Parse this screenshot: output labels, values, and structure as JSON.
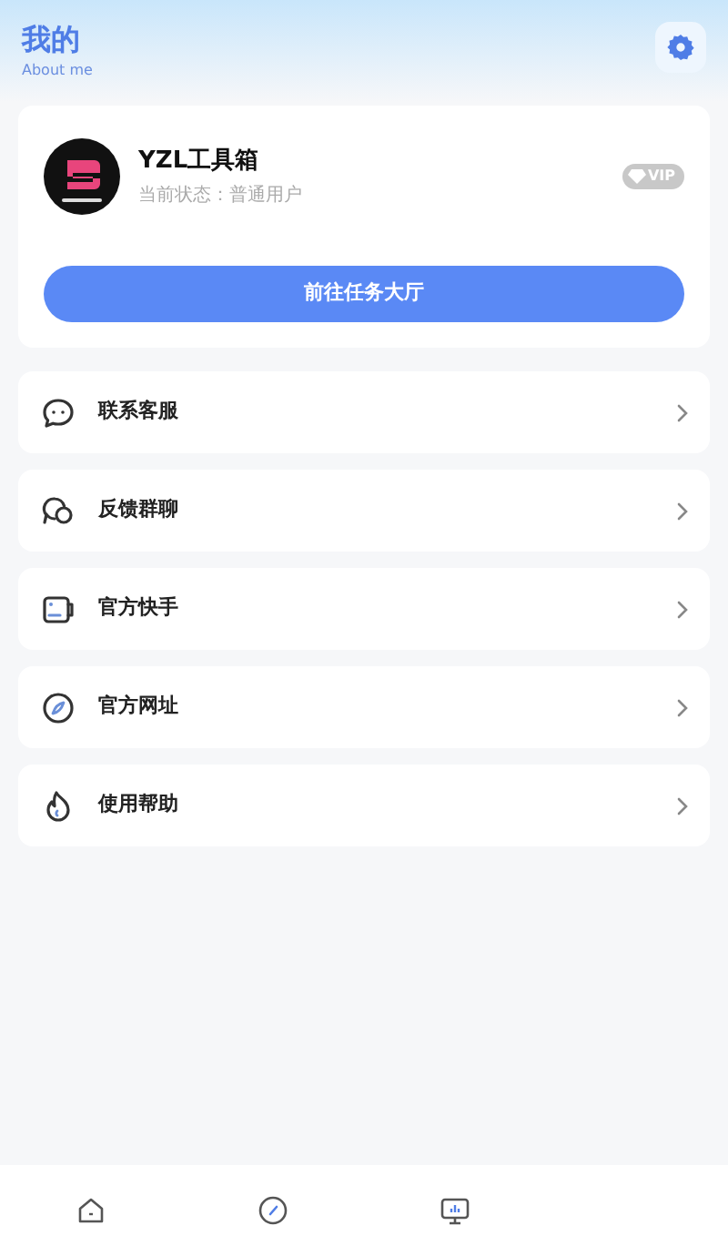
{
  "header": {
    "title": "我的",
    "subtitle": "About me"
  },
  "profile": {
    "name": "YZL工具箱",
    "status": "当前状态：普通用户",
    "badge": "VIP",
    "action": "前往任务大厅"
  },
  "menu": [
    {
      "label": "联系客服",
      "kind": "chat"
    },
    {
      "label": "反馈群聊",
      "kind": "group"
    },
    {
      "label": "官方快手",
      "kind": "card"
    },
    {
      "label": "官方网址",
      "kind": "compass"
    },
    {
      "label": "使用帮助",
      "kind": "flame"
    }
  ],
  "bottom_nav": [
    {
      "kind": "home"
    },
    {
      "kind": "compass"
    },
    {
      "kind": "monitor"
    }
  ]
}
